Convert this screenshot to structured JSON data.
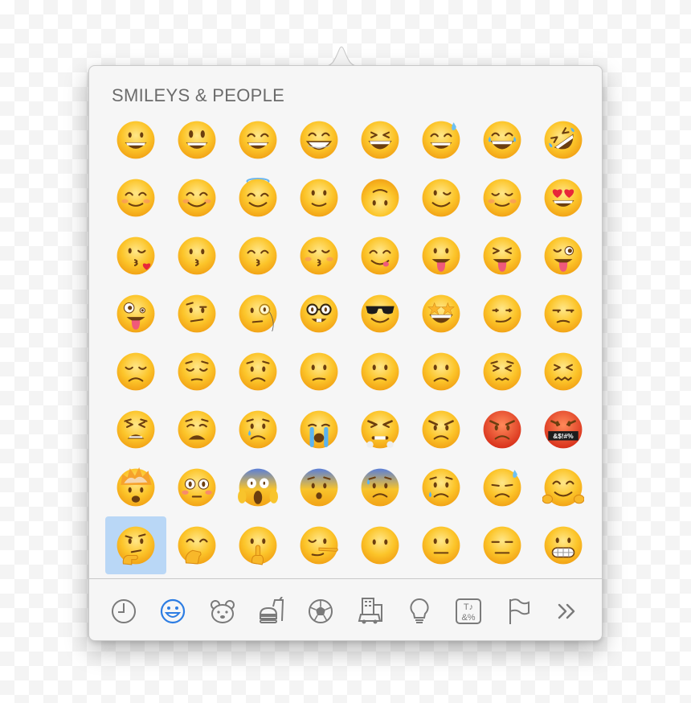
{
  "section": {
    "title": "SMILEYS & PEOPLE"
  },
  "colors": {
    "accent": "#2d7de3",
    "icon": "#7a7a7a",
    "selected_bg": "#b9d7f6",
    "face": "#fdc52b"
  },
  "emojis": [
    {
      "name": "grinning-face"
    },
    {
      "name": "grinning-face-big-eyes"
    },
    {
      "name": "grinning-face-smiling-eyes"
    },
    {
      "name": "beaming-face"
    },
    {
      "name": "grinning-squinting-face"
    },
    {
      "name": "grinning-face-sweat"
    },
    {
      "name": "face-tears-of-joy"
    },
    {
      "name": "rolling-on-floor-laughing"
    },
    {
      "name": "smiling-face"
    },
    {
      "name": "smiling-face-smiling-eyes"
    },
    {
      "name": "smiling-face-halo"
    },
    {
      "name": "slightly-smiling-face"
    },
    {
      "name": "upside-down-face"
    },
    {
      "name": "winking-face"
    },
    {
      "name": "relieved-face"
    },
    {
      "name": "heart-eyes"
    },
    {
      "name": "face-blowing-kiss"
    },
    {
      "name": "kissing-face"
    },
    {
      "name": "kissing-face-smiling-eyes"
    },
    {
      "name": "kissing-face-closed-eyes"
    },
    {
      "name": "face-savoring-food"
    },
    {
      "name": "face-with-tongue"
    },
    {
      "name": "squinting-face-tongue"
    },
    {
      "name": "winking-face-tongue"
    },
    {
      "name": "zany-face"
    },
    {
      "name": "face-raised-eyebrow"
    },
    {
      "name": "face-with-monocle"
    },
    {
      "name": "nerd-face"
    },
    {
      "name": "smiling-face-sunglasses"
    },
    {
      "name": "star-struck"
    },
    {
      "name": "smirking-face"
    },
    {
      "name": "unamused-face"
    },
    {
      "name": "disappointed-face"
    },
    {
      "name": "pensive-face"
    },
    {
      "name": "worried-face"
    },
    {
      "name": "confused-face"
    },
    {
      "name": "slightly-frowning-face"
    },
    {
      "name": "frowning-face"
    },
    {
      "name": "persevering-face"
    },
    {
      "name": "confounded-face"
    },
    {
      "name": "tired-face"
    },
    {
      "name": "weary-face"
    },
    {
      "name": "crying-face"
    },
    {
      "name": "loudly-crying-face"
    },
    {
      "name": "face-steam-from-nose"
    },
    {
      "name": "angry-face"
    },
    {
      "name": "pouting-face"
    },
    {
      "name": "face-with-symbols"
    },
    {
      "name": "exploding-head"
    },
    {
      "name": "flushed-face"
    },
    {
      "name": "face-screaming-in-fear"
    },
    {
      "name": "fearful-face"
    },
    {
      "name": "anxious-face-sweat"
    },
    {
      "name": "sad-but-relieved-face"
    },
    {
      "name": "downcast-face-sweat"
    },
    {
      "name": "hugging-face"
    },
    {
      "name": "thinking-face",
      "selected": true
    },
    {
      "name": "face-hand-over-mouth"
    },
    {
      "name": "shushing-face"
    },
    {
      "name": "lying-face"
    },
    {
      "name": "face-without-mouth"
    },
    {
      "name": "neutral-face"
    },
    {
      "name": "expressionless-face"
    },
    {
      "name": "grimacing-face"
    }
  ],
  "symbols_text": "&$!#%",
  "tabs": [
    {
      "icon": "clock-icon",
      "label": "Frequently Used"
    },
    {
      "icon": "smiley-icon",
      "label": "Smileys & People",
      "active": true
    },
    {
      "icon": "bear-icon",
      "label": "Animals & Nature"
    },
    {
      "icon": "burger-drink-icon",
      "label": "Food & Drink"
    },
    {
      "icon": "soccer-ball-icon",
      "label": "Activity"
    },
    {
      "icon": "building-car-icon",
      "label": "Travel & Places"
    },
    {
      "icon": "lightbulb-icon",
      "label": "Objects"
    },
    {
      "icon": "symbols-icon",
      "label": "Symbols"
    },
    {
      "icon": "flag-icon",
      "label": "Flags"
    },
    {
      "icon": "chevrons-right-icon",
      "label": "More"
    }
  ],
  "symbols_tab_text": {
    "top": "T♪",
    "bottom": "&%"
  }
}
